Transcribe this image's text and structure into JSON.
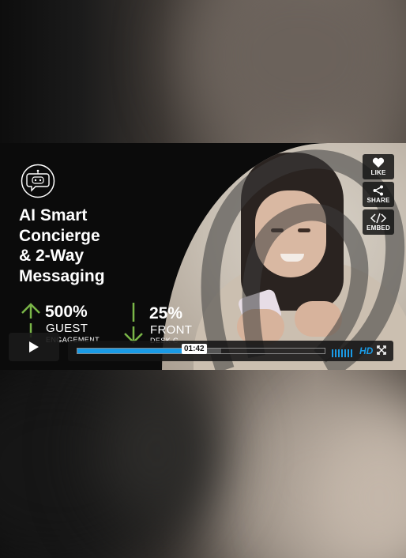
{
  "headline": {
    "lines": [
      "AI Smart",
      "Concierge",
      "& 2-Way",
      "Messaging"
    ]
  },
  "stats": [
    {
      "value": "500%",
      "label": "GUEST",
      "sublabel": "ENGAGEMENT",
      "direction": "up",
      "color": "#7ab648"
    },
    {
      "value": "25%",
      "label": "FRONT",
      "sublabel": "DESK C",
      "direction": "down",
      "color": "#7ab648"
    }
  ],
  "sidebar": {
    "like_label": "LIKE",
    "share_label": "SHARE",
    "embed_label": "EMBED"
  },
  "controls": {
    "current_time": "01:42",
    "hd_label": "HD",
    "progress": 0.44,
    "buffered": 0.58,
    "accent_color": "#1a9be6"
  },
  "icons": [
    "chat-bot-icon",
    "heart-icon",
    "share-icon",
    "code-icon",
    "play-icon",
    "volume-icon",
    "fullscreen-icon",
    "up-arrow-icon",
    "down-arrow-icon"
  ]
}
